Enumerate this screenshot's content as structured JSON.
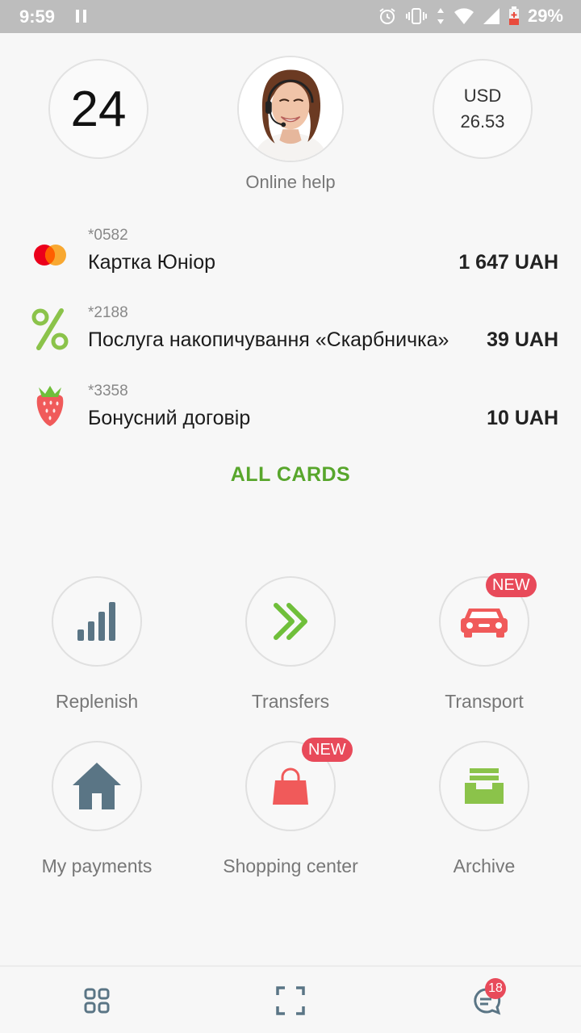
{
  "status_bar": {
    "time": "9:59",
    "battery_pct": "29%"
  },
  "top": {
    "support_number": "24",
    "help_label": "Online help",
    "currency_code": "USD",
    "currency_rate": "26.53"
  },
  "cards": [
    {
      "number": "*0582",
      "name": "Картка Юніор",
      "amount": "1 647 UAH",
      "icon": "mastercard-icon"
    },
    {
      "number": "*2188",
      "name": "Послуга накопичування «Скарбничка»",
      "amount": "39 UAH",
      "icon": "percent-icon"
    },
    {
      "number": "*3358",
      "name": "Бонусний договір",
      "amount": "10 UAH",
      "icon": "strawberry-icon"
    }
  ],
  "all_cards_label": "ALL CARDS",
  "actions": {
    "replenish": "Replenish",
    "transfers": "Transfers",
    "transport": "Transport",
    "my_payments": "My payments",
    "shopping_center": "Shopping center",
    "archive": "Archive",
    "new_badge": "NEW"
  },
  "bottom_nav": {
    "chat_badge_count": "18"
  },
  "colors": {
    "accent_green": "#58a62c",
    "badge_red": "#e84a5a",
    "icon_slate": "#5a7585"
  }
}
